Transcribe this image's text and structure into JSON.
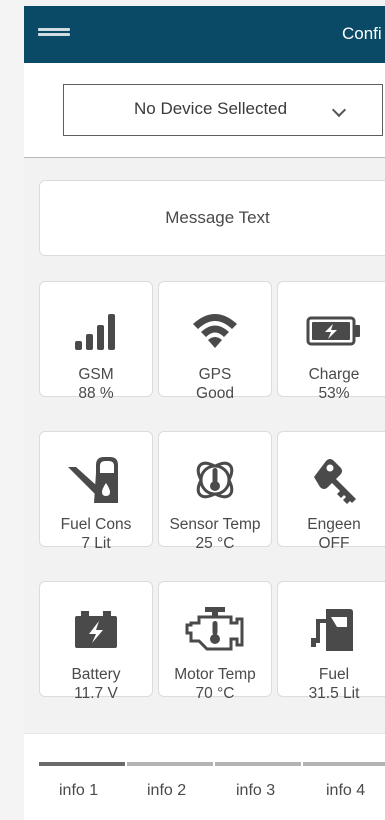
{
  "header": {
    "title": "Confi",
    "menu_icon": "hamburger-menu-icon",
    "color": "#0b4a66"
  },
  "device_select": {
    "value": "No Device Sellected"
  },
  "message": {
    "text": "Message Text"
  },
  "tiles": [
    {
      "icon": "signal-bars-icon",
      "label": "GSM",
      "value": "88 %"
    },
    {
      "icon": "wifi-icon",
      "label": "GPS",
      "value": "Good"
    },
    {
      "icon": "battery-charging-icon",
      "label": "Charge",
      "value": "53%"
    },
    {
      "icon": "fuel-can-icon",
      "label": "Fuel Cons",
      "value": "7 Lit"
    },
    {
      "icon": "thermometer-icon",
      "label": "Sensor Temp",
      "value": "25 °C"
    },
    {
      "icon": "key-icon",
      "label": "Engeen",
      "value": "OFF"
    },
    {
      "icon": "car-battery-icon",
      "label": "Battery",
      "value": "11.7 V"
    },
    {
      "icon": "engine-temp-icon",
      "label": "Motor Temp",
      "value": "70 °C"
    },
    {
      "icon": "fuel-pump-icon",
      "label": "Fuel",
      "value": "31.5 Lit"
    }
  ],
  "tabs": [
    {
      "label": "info 1",
      "active": true
    },
    {
      "label": "info 2",
      "active": false
    },
    {
      "label": "info 3",
      "active": false
    },
    {
      "label": "info 4",
      "active": false
    }
  ],
  "colors": {
    "icon": "#4a4a4a",
    "tab_active": "#6b6b6b",
    "tab_inactive": "#b3b3b3"
  }
}
